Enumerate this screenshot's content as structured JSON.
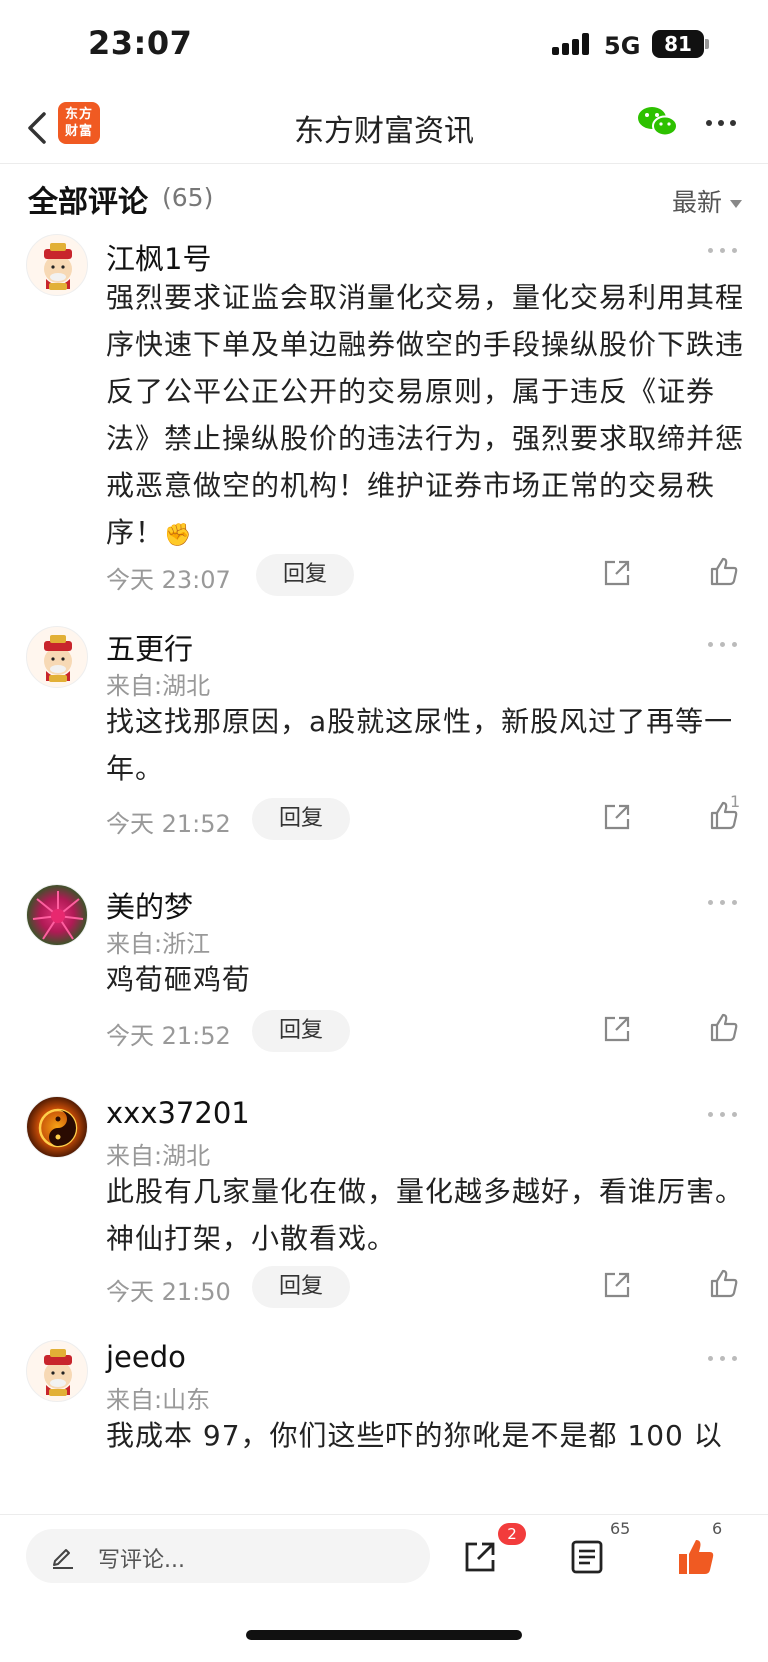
{
  "status_bar": {
    "time": "23:07",
    "network": "5G",
    "battery": "81"
  },
  "nav": {
    "title": "东方财富资讯",
    "logo_line1": "东方",
    "logo_line2": "财富",
    "icons": [
      "back-chevron-icon",
      "wechat-icon",
      "more-icon"
    ]
  },
  "comments_header": {
    "title": "全部评论",
    "count": "(65)",
    "sort_label": "最新"
  },
  "comments": [
    {
      "username": "江枫1号",
      "location": "",
      "text": "强烈要求证监会取消量化交易，量化交易利用其程序快速下单及单边融券做空的手段操纵股价下跌违反了公平公正公开的交易原则，属于违反《证券法》禁止操纵股价的违法行为，强烈要求取缔并惩戒恶意做空的机构！维护证券市场正常的交易秩序！",
      "emoji": "✊",
      "time": "今天 23:07",
      "reply_label": "回复",
      "likes": ""
    },
    {
      "username": "五更行",
      "location": "来自:湖北",
      "text": "找这找那原因，a股就这尿性，新股风过了再等一年。",
      "time": "今天 21:52",
      "reply_label": "回复",
      "likes": "1"
    },
    {
      "username": "美的梦",
      "location": "来自:浙江",
      "text": "鸡荀砸鸡荀",
      "time": "今天 21:52",
      "reply_label": "回复",
      "likes": ""
    },
    {
      "username": "xxx37201",
      "location": "来自:湖北",
      "text": "此股有几家量化在做，量化越多越好，看谁厉害。神仙打架，小散看戏。",
      "time": "今天 21:50",
      "reply_label": "回复",
      "likes": ""
    },
    {
      "username": "jeedo",
      "location": "来自:山东",
      "text": "我成本 97，你们这些吓的狝吪是不是都 100 以",
      "time": "",
      "reply_label": "",
      "likes": ""
    }
  ],
  "bottom_bar": {
    "input_placeholder": "写评论...",
    "share_badge": "2",
    "comments_count": "65",
    "likes_count": "6"
  },
  "colors": {
    "brand": "#f05a22",
    "badge_red": "#f23c3c",
    "wechat_green": "#2dc100",
    "muted_text": "#999999"
  }
}
